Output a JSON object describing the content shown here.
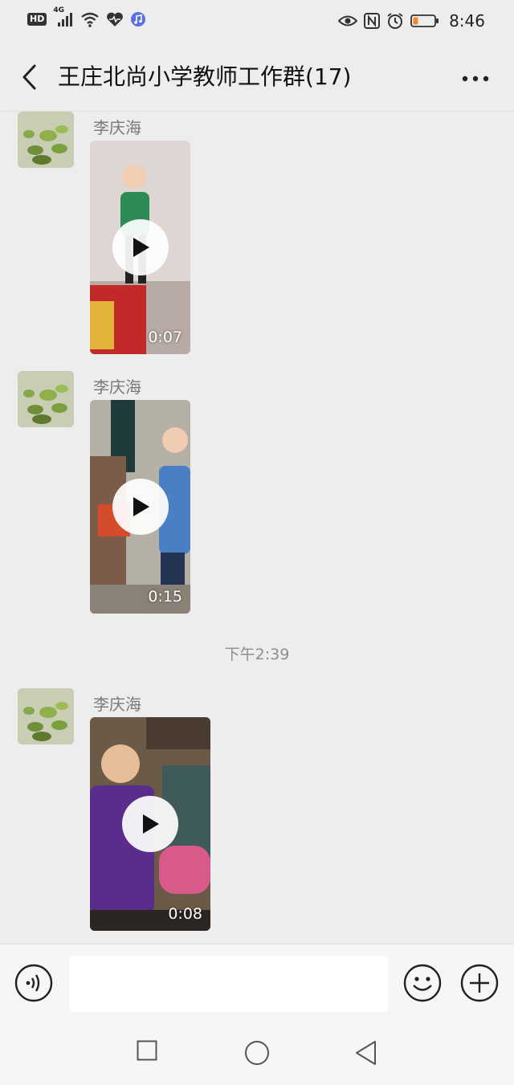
{
  "status_bar": {
    "network_badge": "HD",
    "network_type": "4G",
    "time": "8:46",
    "icons": [
      "hd-icon",
      "signal-4g-icon",
      "wifi-icon",
      "heart-health-icon",
      "music-app-icon",
      "eye-icon",
      "nfc-icon",
      "alarm-icon",
      "battery-low-icon"
    ]
  },
  "nav": {
    "title": "王庄北尚小学教师工作群(17)",
    "back_icon": "chevron-left-icon",
    "more_icon": "more-dots-icon"
  },
  "messages": [
    {
      "sender": "李庆海",
      "type": "video",
      "duration": "0:07"
    },
    {
      "sender": "李庆海",
      "type": "video",
      "duration": "0:15"
    },
    {
      "timestamp": "下午2:39"
    },
    {
      "sender": "李庆海",
      "type": "video",
      "duration": "0:08"
    }
  ],
  "input_bar": {
    "text_value": "",
    "voice_icon": "voice-input-icon",
    "emoji_icon": "emoji-icon",
    "plus_icon": "plus-circle-icon"
  },
  "system_nav": {
    "icons": [
      "recent-apps-icon",
      "home-icon",
      "back-triangle-icon"
    ]
  },
  "colors": {
    "background": "#ededed",
    "input_bar": "#f6f6f6",
    "sender_text": "#7a7a7a",
    "battery_low": "#f08a2c"
  }
}
